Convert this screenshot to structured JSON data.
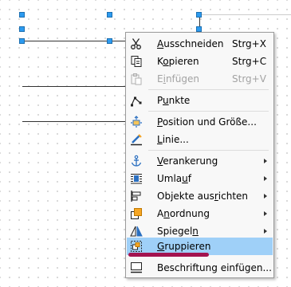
{
  "menu": {
    "items": [
      {
        "label_html": "<u>A</u>usschneiden",
        "shortcut": "Strg+X",
        "icon": "scissors-icon",
        "disabled": false,
        "submenu": false
      },
      {
        "label_html": "K<u>o</u>pieren",
        "shortcut": "Strg+C",
        "icon": "copy-icon",
        "disabled": false,
        "submenu": false
      },
      {
        "label_html": "E<u>i</u>nfügen",
        "shortcut": "Strg+V",
        "icon": "paste-icon",
        "disabled": true,
        "submenu": false
      },
      {
        "label_html": "P<u>u</u>nkte",
        "shortcut": "",
        "icon": "points-icon",
        "disabled": false,
        "submenu": false
      },
      {
        "label_html": "<u>P</u>osition und Größe...",
        "shortcut": "",
        "icon": "position-size-icon",
        "disabled": false,
        "submenu": false
      },
      {
        "label_html": "<u>L</u>inie...",
        "shortcut": "",
        "icon": "line-icon",
        "disabled": false,
        "submenu": false
      },
      {
        "label_html": "<u>V</u>erankerung",
        "shortcut": "",
        "icon": "anchor-icon",
        "disabled": false,
        "submenu": true
      },
      {
        "label_html": "Umla<u>u</u>f",
        "shortcut": "",
        "icon": "wrap-icon",
        "disabled": false,
        "submenu": true
      },
      {
        "label_html": "Objekte aus<u>r</u>ichten",
        "shortcut": "",
        "icon": "align-icon",
        "disabled": false,
        "submenu": true
      },
      {
        "label_html": "A<u>n</u>ordnung",
        "shortcut": "",
        "icon": "arrange-icon",
        "disabled": false,
        "submenu": true
      },
      {
        "label_html": "Spiegel<u>n</u>",
        "shortcut": "",
        "icon": "flip-icon",
        "disabled": false,
        "submenu": true
      },
      {
        "label_html": "<u>G</u>ruppieren",
        "shortcut": "",
        "icon": "group-icon",
        "disabled": false,
        "submenu": false,
        "highlight": true
      },
      {
        "label_html": "Beschriftung einfügen...",
        "shortcut": "",
        "icon": "caption-icon",
        "disabled": false,
        "submenu": false
      }
    ]
  },
  "colors": {
    "highlight": "#9fd0f8",
    "handle": "#2d9bf0",
    "annotation": "#a3134f"
  }
}
